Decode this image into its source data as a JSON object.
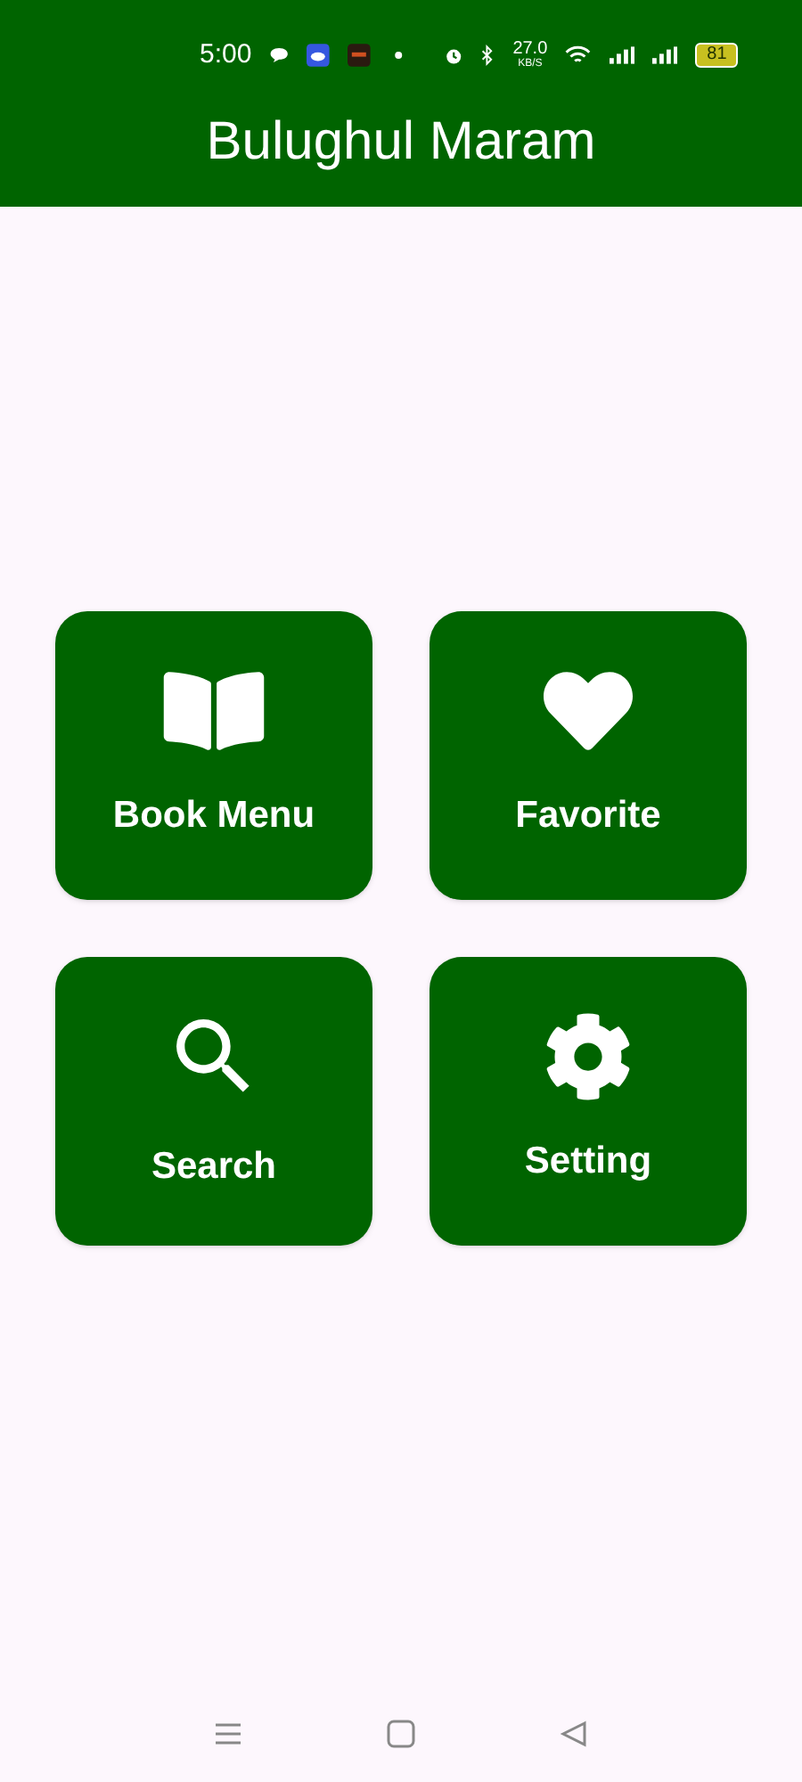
{
  "status_bar": {
    "time": "5:00",
    "speed": "27.0",
    "speed_unit": "KB/S",
    "battery": "81"
  },
  "app_bar": {
    "title": "Bulughul Maram"
  },
  "menu": [
    {
      "label": "Book Menu",
      "kind": "book"
    },
    {
      "label": "Favorite",
      "kind": "heart"
    },
    {
      "label": "Search",
      "kind": "search"
    },
    {
      "label": "Setting",
      "kind": "gear"
    }
  ]
}
